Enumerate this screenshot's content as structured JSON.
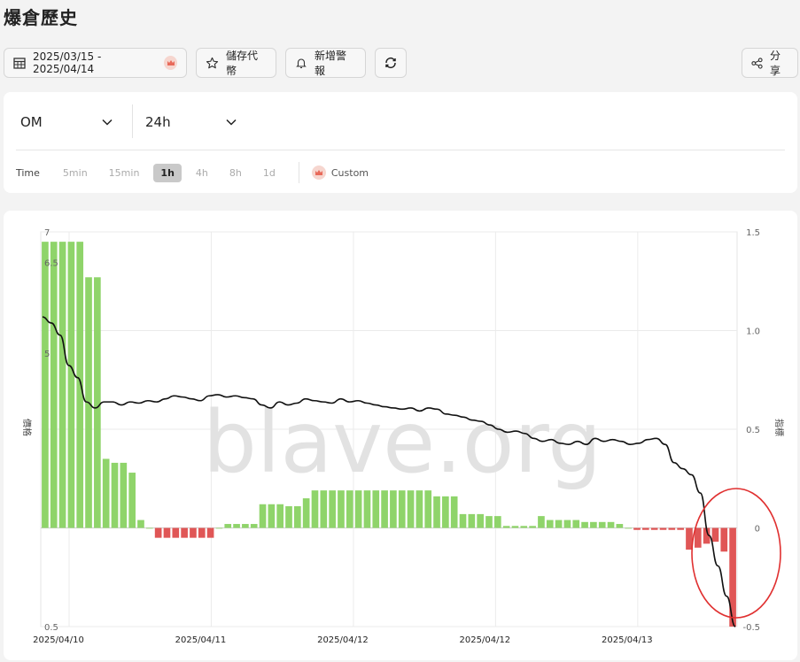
{
  "page": {
    "title": "爆倉歷史"
  },
  "toolbar": {
    "date_range": "2025/03/15 - 2025/04/14",
    "save_label": "儲存代幣",
    "alert_label": "新增警報",
    "share_label": "分享"
  },
  "selectors": {
    "symbol": "OM",
    "period": "24h"
  },
  "time_filter": {
    "label": "Time",
    "options": [
      "5min",
      "15min",
      "1h",
      "4h",
      "8h",
      "1d"
    ],
    "active": "1h",
    "custom_label": "Custom"
  },
  "colors": {
    "positive": "#8fd46a",
    "negative": "#e05656",
    "price": "#111111",
    "highlight": "#e03030",
    "premium": "#e86a5a"
  },
  "chart_data": {
    "type": "bar",
    "watermark": "blave.org",
    "y_left": {
      "label": "價格",
      "ylim": [
        0.5,
        7
      ],
      "ticks": [
        "7",
        "6.5",
        "5",
        "0.5"
      ]
    },
    "y_right": {
      "label": "指標",
      "ylim": [
        -0.5,
        1.5
      ],
      "ticks": [
        "1.5",
        "1.0",
        "0.5",
        "0",
        "-0.5"
      ]
    },
    "x_ticks": [
      "2025/04/10",
      "2025/04/11",
      "2025/04/12",
      "2025/04/12",
      "2025/04/13"
    ],
    "grid": true,
    "bars": [
      1.45,
      1.45,
      1.45,
      1.45,
      1.45,
      1.27,
      1.27,
      0.35,
      0.33,
      0.33,
      0.28,
      0.04,
      0,
      -0.05,
      -0.05,
      -0.05,
      -0.05,
      -0.05,
      -0.05,
      -0.05,
      0,
      0.02,
      0.02,
      0.02,
      0.02,
      0.12,
      0.12,
      0.12,
      0.11,
      0.11,
      0.15,
      0.19,
      0.19,
      0.19,
      0.19,
      0.19,
      0.19,
      0.19,
      0.19,
      0.19,
      0.19,
      0.19,
      0.19,
      0.19,
      0.19,
      0.16,
      0.16,
      0.16,
      0.07,
      0.07,
      0.07,
      0.06,
      0.06,
      0.01,
      0.01,
      0.01,
      0.01,
      0.06,
      0.04,
      0.04,
      0.04,
      0.04,
      0.03,
      0.03,
      0.03,
      0.03,
      0.02,
      0,
      -0.01,
      -0.01,
      -0.01,
      -0.01,
      -0.01,
      -0.01,
      -0.11,
      -0.1,
      -0.08,
      -0.07,
      -0.12,
      -0.5
    ],
    "price_line": [
      5.6,
      5.5,
      5.3,
      4.8,
      4.6,
      4.2,
      4.1,
      4.2,
      4.2,
      4.15,
      4.2,
      4.18,
      4.22,
      4.2,
      4.25,
      4.3,
      4.28,
      4.25,
      4.22,
      4.3,
      4.32,
      4.28,
      4.3,
      4.27,
      4.25,
      4.15,
      4.1,
      4.2,
      4.15,
      4.18,
      4.25,
      4.22,
      4.2,
      4.18,
      4.25,
      4.2,
      4.22,
      4.18,
      4.15,
      4.12,
      4.1,
      4.08,
      4.1,
      4.05,
      4.1,
      4.08,
      4.0,
      3.98,
      3.95,
      3.9,
      3.88,
      3.82,
      3.75,
      3.7,
      3.72,
      3.68,
      3.6,
      3.55,
      3.58,
      3.52,
      3.5,
      3.55,
      3.5,
      3.6,
      3.55,
      3.58,
      3.55,
      3.5,
      3.52,
      3.58,
      3.6,
      3.5,
      3.2,
      3.1,
      3.0,
      2.7,
      2.0,
      1.5,
      1.0,
      0.5
    ]
  }
}
